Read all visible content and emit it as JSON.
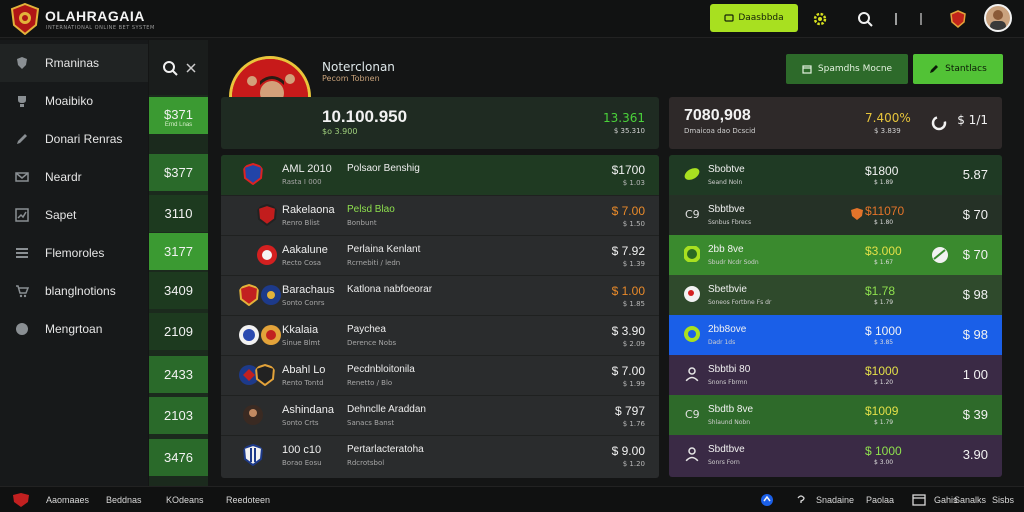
{
  "header": {
    "brand": "OLAHRAGAIA",
    "brand_sub": "INTERNATIONAL ONLINE BET SYSTEM",
    "top_button": "Daasbbda",
    "colors": {
      "accent": "#a8e020",
      "brand_red": "#c71a1a",
      "green_dark": "#2d6a2a",
      "green_bright": "#52c236"
    }
  },
  "sidebar": {
    "items": [
      {
        "label": "Rmaninas",
        "icon": "shield-icon"
      },
      {
        "label": "Moaibiko",
        "icon": "trophy-icon"
      },
      {
        "label": "Donari Renras",
        "icon": "pen-icon"
      },
      {
        "label": "Neardr",
        "icon": "envelope-icon"
      },
      {
        "label": "Sapet",
        "icon": "chart-icon"
      },
      {
        "label": "Flemoroles",
        "icon": "list-icon"
      },
      {
        "label": "blanglnotions",
        "icon": "cart-icon"
      },
      {
        "label": "Mengrtoan",
        "icon": "globe-icon"
      }
    ]
  },
  "odds_column": [
    {
      "value": "$371",
      "sub": "Ernd Lnas"
    },
    {
      "value": "$377",
      "sub": ""
    },
    {
      "value": "3110",
      "sub": ""
    },
    {
      "value": "3177",
      "sub": ""
    },
    {
      "value": "3409",
      "sub": ""
    },
    {
      "value": "2109",
      "sub": ""
    },
    {
      "value": "2433",
      "sub": ""
    },
    {
      "value": "2103",
      "sub": ""
    },
    {
      "value": "3476",
      "sub": ""
    }
  ],
  "profile": {
    "name": "Noterclonan",
    "sub": "Pecom Tobnen"
  },
  "actions": {
    "secondary": "Spamdhs Mocne",
    "primary": "Stantlacs"
  },
  "hero": {
    "value": "10.100.950",
    "sub": "$o 3.900",
    "right_value": "13.361",
    "right_sub": "$ 35.310"
  },
  "matches": [
    {
      "team": "AML 2010",
      "team_sub": "Rasta I 000",
      "detail": "Polsaor Benshig",
      "detail_sub": "",
      "odd": "$1700",
      "odd_sub": "$ 1.03"
    },
    {
      "team": "Rakelaona",
      "team_sub": "Renro Blist",
      "detail": "Pelsd Blao",
      "detail_sub": "Bonbunt",
      "odd": "$ 7.00",
      "odd_sub": "$ 1.50"
    },
    {
      "team": "Aakalune",
      "team_sub": "Recto Cosa",
      "detail": "Perlaina Kenlant",
      "detail_sub": "Rcrnebiti / ledn",
      "odd": "$ 7.92",
      "odd_sub": "$ 1.39"
    },
    {
      "team": "Barachaus",
      "team_sub": "Sonto Conrs",
      "detail": "Katlona nabfoeorar",
      "detail_sub": "",
      "odd": "$ 1.00",
      "odd_sub": "$ 1.85"
    },
    {
      "team": "Kkalaia",
      "team_sub": "Sinue Blmt",
      "detail": "Paychea",
      "detail_sub": "Derence Nobs",
      "odd": "$ 3.90",
      "odd_sub": "$ 2.09"
    },
    {
      "team": "Abahl Lo",
      "team_sub": "Rento Tontd",
      "detail": "Pecdnbloitonila",
      "detail_sub": "Renetto / Blo",
      "odd": "$ 7.00",
      "odd_sub": "$ 1.99"
    },
    {
      "team": "Ashindana",
      "team_sub": "Sonto Crts",
      "detail": "Dehnclle Araddan",
      "detail_sub": "Sanacs Banst",
      "odd": "$ 797",
      "odd_sub": "$ 1.76"
    },
    {
      "team": "100 c10",
      "team_sub": "Borao Eosu",
      "detail": "Pertarlacteratoha",
      "detail_sub": "Rdcrotsbol",
      "odd": "$ 9.00",
      "odd_sub": "$ 1.20"
    }
  ],
  "right_hero": {
    "value": "7080,908",
    "sub": "Dmaicoa dao Dcscid",
    "pct": "7.400%",
    "pct_sub": "$ 3.839",
    "right": "$ 1/1"
  },
  "right_rows": [
    {
      "name": "Sbobtve",
      "sub": "Seand Noln",
      "odd": "$1800",
      "odd_sub": "$ 1.89",
      "val": "5.87"
    },
    {
      "name": "Sbbtbve",
      "sub": "Ssnbus Fbrecs",
      "odd": "$11070",
      "odd_sub": "$ 1.80",
      "val": "$ 70"
    },
    {
      "name": "2bb 8ve",
      "sub": "Sbudr Ncdr Sodn",
      "odd": "$3.000",
      "odd_sub": "$ 1.67",
      "val": "$ 70"
    },
    {
      "name": "Sbetbvie",
      "sub": "Soneos Fortbne Fs dr",
      "odd": "$1.78",
      "odd_sub": "$ 1.79",
      "val": "$ 98"
    },
    {
      "name": "2bb8ove",
      "sub": "Dadr 1ds",
      "odd": "$ 1000",
      "odd_sub": "$ 3.85",
      "val": "$ 98"
    },
    {
      "name": "Sbbtbi 80",
      "sub": "Snons Fbrmn",
      "odd": "$1000",
      "odd_sub": "$ 1.20",
      "val": "1 00"
    },
    {
      "name": "Sbdtb 8ve",
      "sub": "Shlaund Nobn",
      "odd": "$1009",
      "odd_sub": "$ 1.79",
      "val": "$ 39"
    },
    {
      "name": "Sbdtbve",
      "sub": "Sonrs Forn",
      "odd": "$ 1000",
      "odd_sub": "$ 3.00",
      "val": "3.90"
    }
  ],
  "footer": {
    "left": [
      "Aaomaaes",
      "Beddnas",
      "KOdeans",
      "Reedoteen"
    ],
    "right": [
      "Snadaine",
      "Paolaa",
      "Gahis",
      "Sanalks",
      "Sisbs"
    ]
  }
}
